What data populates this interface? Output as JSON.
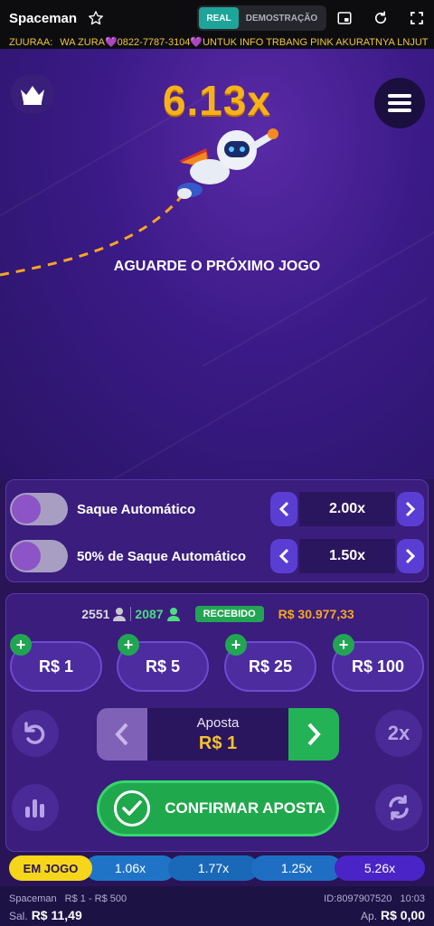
{
  "header": {
    "title": "Spaceman",
    "mode_real": "REAL",
    "mode_demo": "DEMOSTRAÇÃO",
    "icons": [
      "star-icon",
      "pip-icon",
      "refresh-icon",
      "fullscreen-icon"
    ]
  },
  "marquee": {
    "label": "ZUURAA:",
    "text": "WA ZURA💜0822-7787-3104💜UNTUK INFO TRBANG PINK AKURATNYA LNJUT"
  },
  "game": {
    "multiplier": "6.13x",
    "status": "AGUARDE O PRÓXIMO JOGO"
  },
  "auto": {
    "rows": [
      {
        "label": "Saque Automático",
        "value": "2.00x",
        "enabled": false
      },
      {
        "label": "50% de Saque Automático",
        "value": "1.50x",
        "enabled": false
      }
    ]
  },
  "bets": {
    "players": "2551",
    "cashed": "2087",
    "received_label": "RECEBIDO",
    "total": "R$ 30.977,33",
    "chips": [
      "R$ 1",
      "R$ 5",
      "R$ 25",
      "R$ 100"
    ],
    "stake_label": "Aposta",
    "stake_value": "R$ 1",
    "confirm_label": "CONFIRMAR APOSTA",
    "double_label": "2x"
  },
  "history": {
    "live_label": "EM JOGO",
    "items": [
      "1.06x",
      "1.77x",
      "1.25x",
      "5.26x"
    ]
  },
  "footer": {
    "game_name": "Spaceman",
    "limits": "R$ 1 - R$ 500",
    "balance_label": "Sal.",
    "balance_value": "R$ 11,49",
    "round_id": "ID:8097907520",
    "time": "10:03",
    "bet_label": "Ap.",
    "bet_value": "R$ 0,00"
  },
  "colors": {
    "accent_gold": "#f7b21b",
    "green": "#22a553",
    "panel": "#3a1d7c"
  }
}
